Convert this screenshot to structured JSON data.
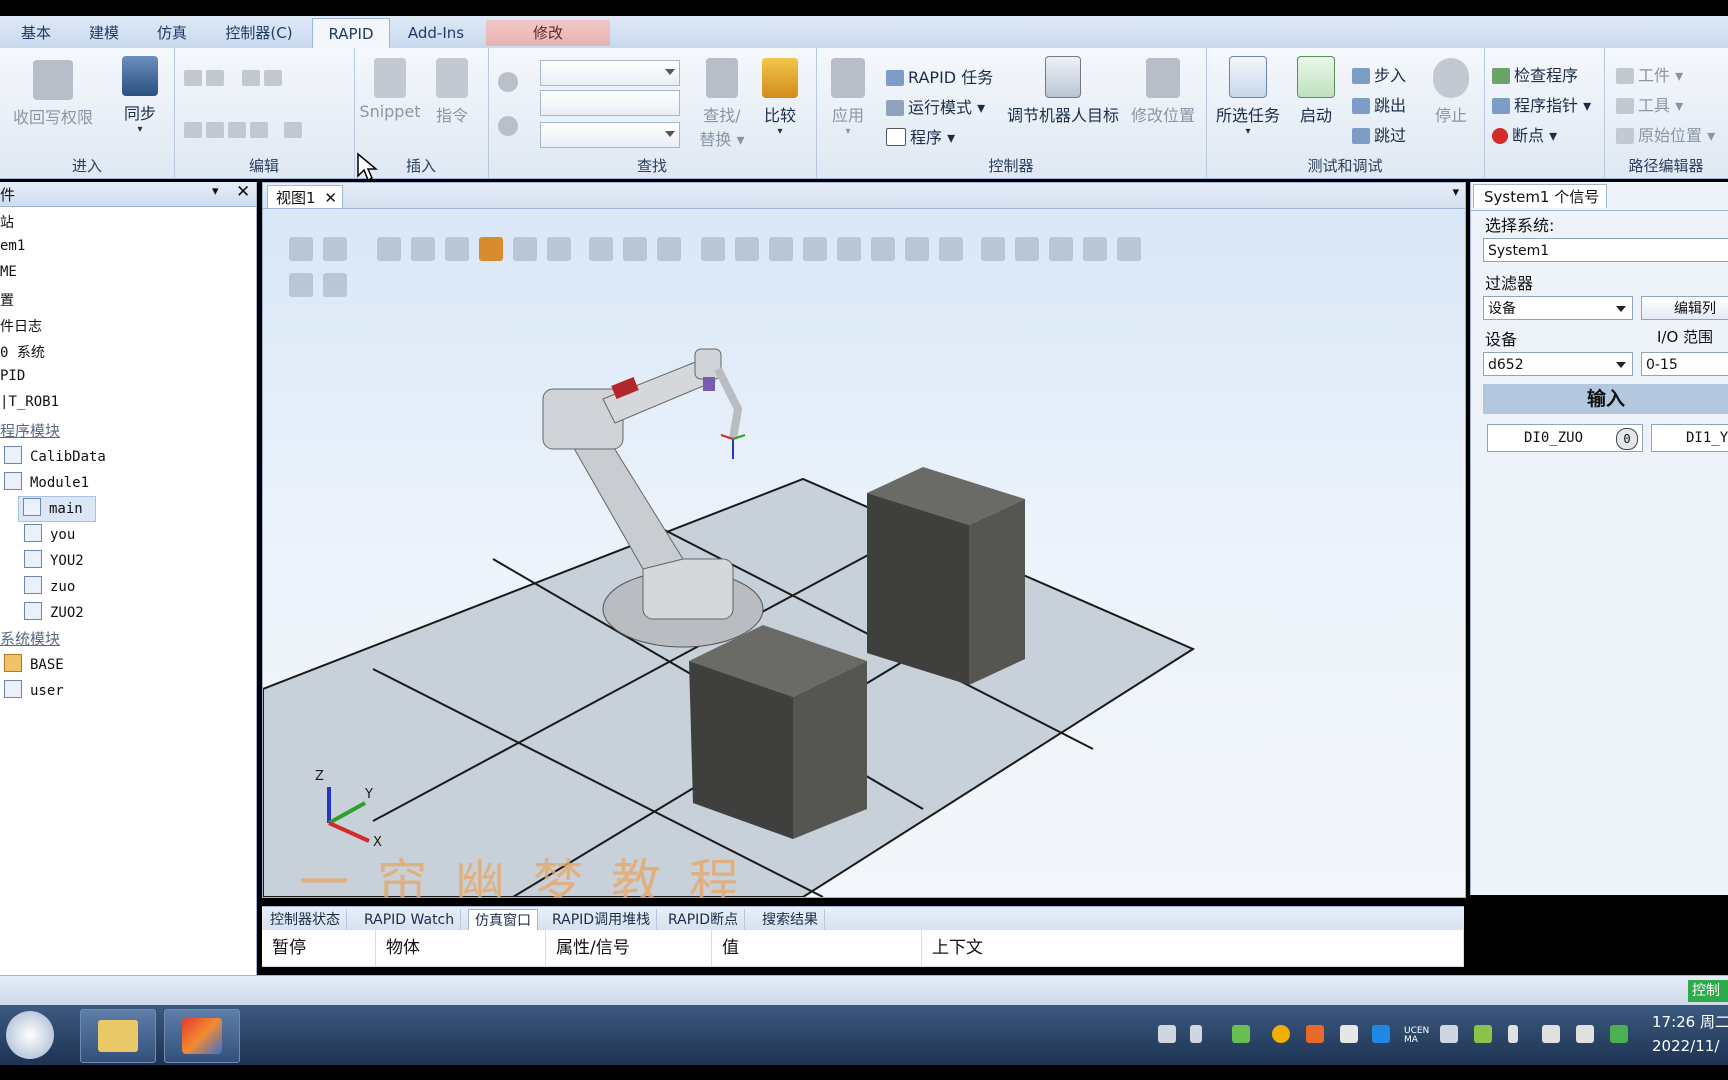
{
  "ribbon_tabs": [
    "基本",
    "建模",
    "仿真",
    "控制器(C)",
    "RAPID",
    "Add-Ins",
    "修改"
  ],
  "ribbon": {
    "groups": {
      "enter": "进入",
      "edit": "编辑",
      "insert": "插入",
      "find": "查找",
      "controller": "控制器",
      "test_debug": "测试和调试",
      "path_editor": "路径编辑器"
    },
    "buttons": {
      "revoke_write": "收回写权限",
      "sync": "同步",
      "snippet": "Snippet",
      "instruction": "指令",
      "find_replace_1": "查找/",
      "find_replace_2": "替换",
      "compare": "比较",
      "apply": "应用",
      "rapid_task": "RAPID 任务",
      "run_mode": "运行模式",
      "program": "程序",
      "adjust_targets": "调节机器人目标",
      "modify_position": "修改位置",
      "selected_task": "所选任务",
      "start": "启动",
      "step_in": "步入",
      "step_out": "跳出",
      "step_over": "跳过",
      "stop": "停止",
      "check_program": "检查程序",
      "program_pointer": "程序指针",
      "breakpoint": "断点",
      "workobject": "工件",
      "tool": "工具",
      "home_position": "原始位置"
    }
  },
  "left_panel": {
    "header": "件",
    "tree": [
      {
        "text": "站",
        "kind": "plain"
      },
      {
        "text": "em1",
        "kind": "plain"
      },
      {
        "text": "ME",
        "kind": "plain"
      },
      {
        "text": "置",
        "kind": "plain"
      },
      {
        "text": "件日志",
        "kind": "plain"
      },
      {
        "text": "0 系统",
        "kind": "plain"
      },
      {
        "text": "PID",
        "kind": "plain"
      },
      {
        "text": "T_ROB1",
        "kind": "plain"
      },
      {
        "text": "程序模块",
        "kind": "link"
      },
      {
        "text": "CalibData",
        "kind": "module"
      },
      {
        "text": "Module1",
        "kind": "module"
      },
      {
        "text": "main",
        "kind": "routine",
        "selected": true
      },
      {
        "text": "you",
        "kind": "routine"
      },
      {
        "text": "YOU2",
        "kind": "routine"
      },
      {
        "text": "zuo",
        "kind": "routine"
      },
      {
        "text": "ZUO2",
        "kind": "routine"
      },
      {
        "text": "系统模块",
        "kind": "link"
      },
      {
        "text": "BASE",
        "kind": "module"
      },
      {
        "text": "user",
        "kind": "module"
      }
    ]
  },
  "view": {
    "tab_label": "视图1",
    "watermark": "一帘幽梦教程",
    "axes": {
      "x": "X",
      "y": "Y",
      "z": "Z"
    }
  },
  "output": {
    "tabs": [
      "控制器状态",
      "RAPID Watch",
      "仿真窗口",
      "RAPID调用堆栈",
      "RAPID断点",
      "搜索结果"
    ],
    "active_tab": "仿真窗口",
    "columns": [
      "暂停",
      "物体",
      "属性/信号",
      "值",
      "上下文"
    ]
  },
  "right_panel": {
    "tab": "System1 个信号",
    "select_system_label": "选择系统:",
    "system_value": "System1",
    "filter_label": "过滤器",
    "filter_value": "设备",
    "edit_list": "编辑列",
    "device_label": "设备",
    "io_range_label": "I/O 范围",
    "device_value": "d652",
    "io_range_value": "0-15",
    "input_header": "输入",
    "signals": [
      "DI0_ZUO",
      "DI1_Y"
    ],
    "signal_state": "0"
  },
  "statusbar": {
    "controller_status": "控制"
  },
  "taskbar": {
    "time": "17:26 周二",
    "date": "2022/11/",
    "tray_text": "UCEN MA"
  },
  "colors": {
    "ribbon_bg": "#e6eef8",
    "accent_blue": "#1f3b67",
    "modify_tab": "#e8b3b3",
    "watermark": "#e8a96a",
    "block_gray": "#4a4a48",
    "status_green": "#2eaa4a"
  }
}
